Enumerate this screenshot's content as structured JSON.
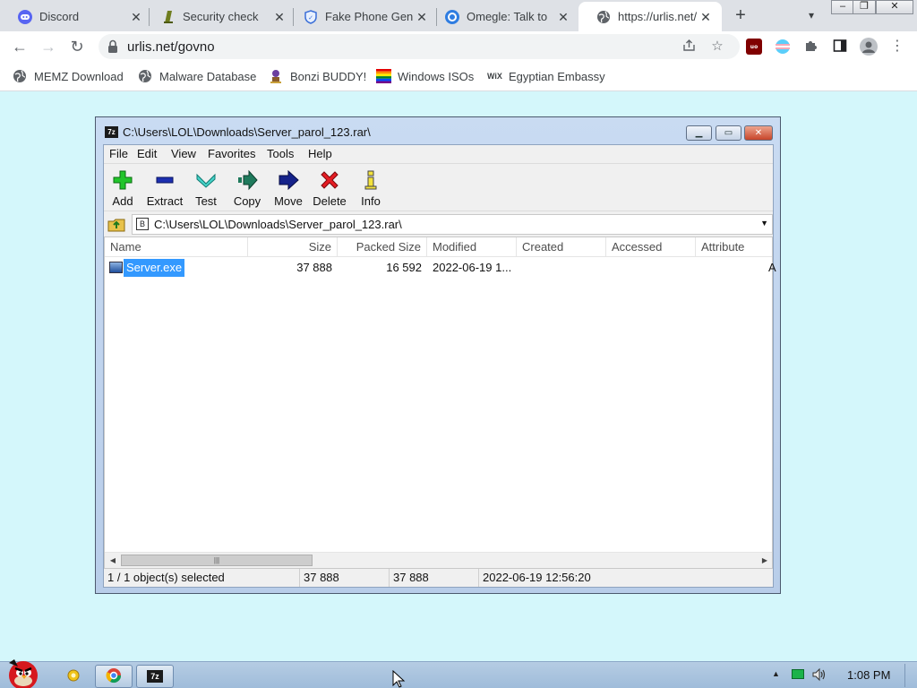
{
  "browser": {
    "tabs": [
      {
        "title": "Discord",
        "icon": "discord-icon",
        "color": "#5865f2"
      },
      {
        "title": "Security check",
        "icon": "security-check-icon",
        "color": "#7c8b2b"
      },
      {
        "title": "Fake Phone Gen",
        "icon": "shield-badge-icon",
        "color": "#3b6fd8"
      },
      {
        "title": "Omegle: Talk to",
        "icon": "omegle-icon",
        "color": "#2f7de1"
      },
      {
        "title": "https://urlis.net/",
        "icon": "globe-icon",
        "color": "#5f6368"
      }
    ],
    "address": "urlis.net/govno",
    "bookmarks": [
      {
        "label": "MEMZ Download",
        "icon": "globe-icon"
      },
      {
        "label": "Malware Database",
        "icon": "globe-icon"
      },
      {
        "label": "Bonzi BUDDY!",
        "icon": "bonzi-icon"
      },
      {
        "label": "Windows ISOs",
        "icon": "rainbow-flag-icon"
      },
      {
        "label": "Egyptian Embassy",
        "icon": "wix-icon"
      }
    ],
    "wix_glyph": "WiX"
  },
  "zip": {
    "title": "C:\\Users\\LOL\\Downloads\\Server_parol_123.rar\\",
    "app_glyph": "7z",
    "menu": [
      "File",
      "Edit",
      "View",
      "Favorites",
      "Tools",
      "Help"
    ],
    "toolbar": [
      "Add",
      "Extract",
      "Test",
      "Copy",
      "Move",
      "Delete",
      "Info"
    ],
    "path": "C:\\Users\\LOL\\Downloads\\Server_parol_123.rar\\",
    "columns": [
      "Name",
      "Size",
      "Packed Size",
      "Modified",
      "Created",
      "Accessed",
      "Attribute"
    ],
    "row": {
      "name": "Server.exe",
      "size": "37 888",
      "packed": "16 592",
      "modified": "2022-06-19 1...",
      "created": "",
      "accessed": "",
      "attr": "A"
    },
    "status": {
      "selected": "1 / 1 object(s) selected",
      "size": "37 888",
      "packed": "37 888",
      "date": "2022-06-19 12:56:20"
    }
  },
  "taskbar": {
    "clock": "1:08 PM",
    "app_glyph": "7z"
  },
  "colors": {
    "page_bg": "#d4f7fb",
    "selection": "#3399ff"
  }
}
